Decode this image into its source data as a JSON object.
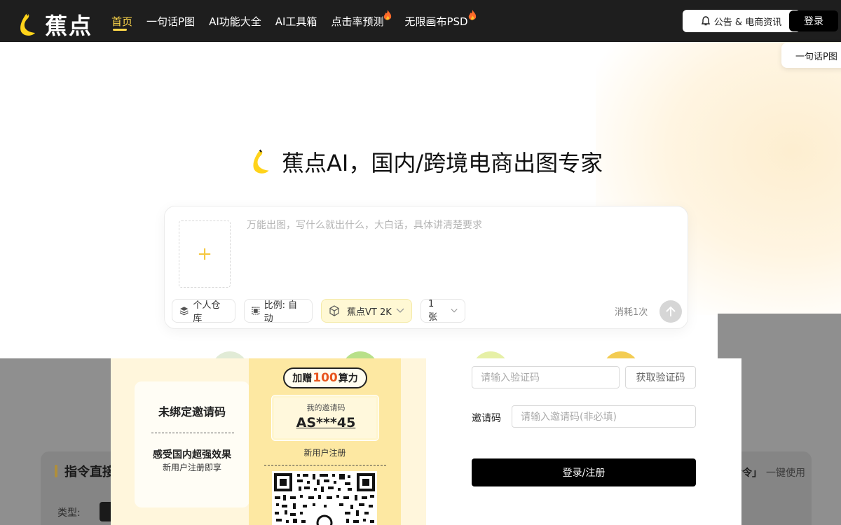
{
  "nav": {
    "brand": "蕉点",
    "items": [
      {
        "label": "首页",
        "active": true,
        "hot": false
      },
      {
        "label": "一句话P图",
        "active": false,
        "hot": false
      },
      {
        "label": "AI功能大全",
        "active": false,
        "hot": false
      },
      {
        "label": "AI工具箱",
        "active": false,
        "hot": false
      },
      {
        "label": "点击率预测",
        "active": false,
        "hot": true
      },
      {
        "label": "无限画布PSD",
        "active": false,
        "hot": true
      }
    ],
    "notice_label": "公告 & 电商资讯",
    "login_label": "登录"
  },
  "floating_tag": "一句话P图",
  "hero": {
    "title": "蕉点AI，国内/跨境电商出图专家"
  },
  "prompt_card": {
    "upload_icon": "+",
    "placeholder": "万能出图，写什么就出什么，大白话，具体讲清楚要求",
    "personal_library": "个人仓库",
    "ratio": "比例: 自动",
    "model": "蕉点VT 2K",
    "count": "1张",
    "consume": "消耗1次"
  },
  "background": {
    "section_title": "指令直接",
    "type_label": "类型:",
    "right_text": "指令」",
    "right_link": "一键使用"
  },
  "modal": {
    "promo": {
      "unbound": "未绑定邀请码",
      "effect": "感受国内超强效果",
      "effect_sub": "新用户注册即享",
      "bonus_prefix": "加赠",
      "bonus_num": "100",
      "bonus_suffix": "算力",
      "code_label": "我的邀请码",
      "code_value": "AS***45",
      "new_user": "新用户注册"
    },
    "form": {
      "verify_placeholder": "请输入验证码",
      "get_code": "获取验证码",
      "invite_label": "邀请码",
      "invite_placeholder": "请输入邀请码(非必填)",
      "submit": "登录/注册"
    }
  },
  "colors": {
    "nav_bg": "#1e1e1e",
    "accent": "#ffd84a",
    "overlay": "#8f8f8f",
    "promo_bg": "#fff6dc",
    "bonus_num": "#e8561e"
  }
}
